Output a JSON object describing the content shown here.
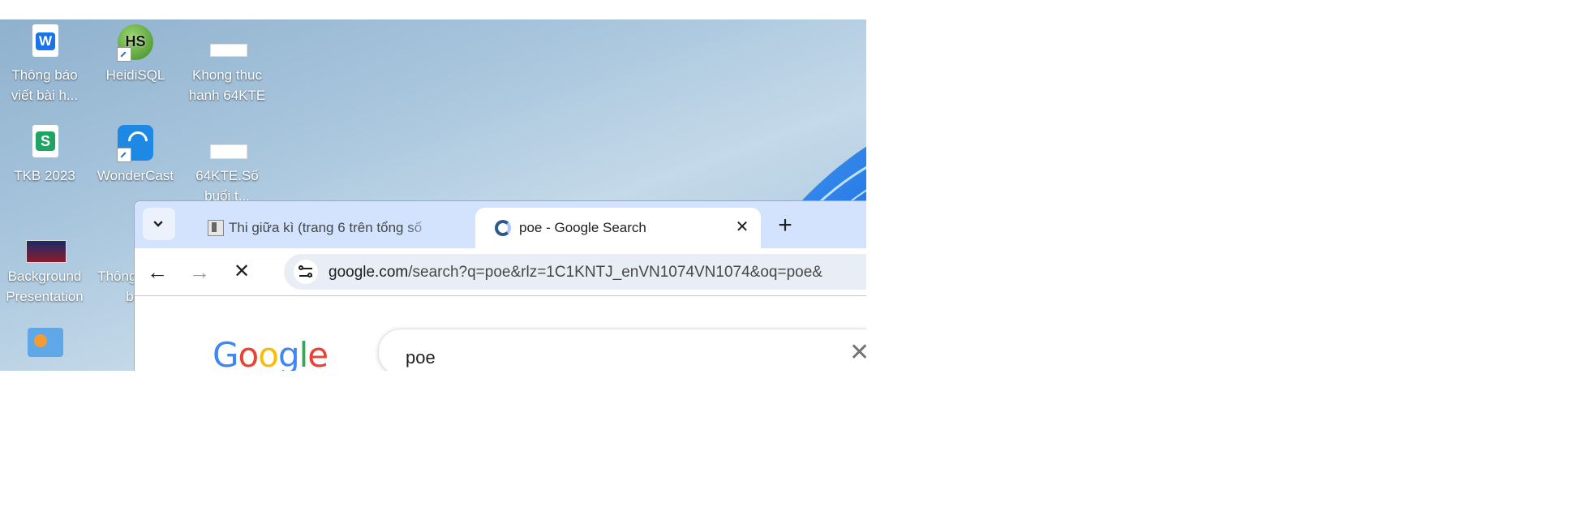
{
  "desktop": {
    "icons": [
      {
        "label": "Thông báo viết bài h...",
        "icon": "wps-writer-doc-icon",
        "color": "#1a73e8"
      },
      {
        "label": "HeidiSQL",
        "icon": "heidisql-icon",
        "color": "#5aa63a"
      },
      {
        "label": "Khong thuc hanh 64KTE",
        "icon": "document-thumbnail-icon"
      },
      {
        "label": "TKB 2023",
        "icon": "wps-spreadsheet-icon",
        "color": "#1fa463"
      },
      {
        "label": "WonderCast",
        "icon": "wondercast-icon",
        "color": "#1e88e5"
      },
      {
        "label": "64KTE.Số buổi t...",
        "icon": "document-thumbnail-icon"
      },
      {
        "label": "Background Presentation",
        "icon": "presentation-thumbnail-icon"
      },
      {
        "label": "Thông... viết b...",
        "icon": "wps-presentation-icon",
        "color": "#e5533d"
      },
      {
        "label": "",
        "icon": "dashboard-app-icon"
      },
      {
        "label": "",
        "icon": "zoom-icon"
      }
    ]
  },
  "browser": {
    "tabs": [
      {
        "title": "Thi giữa kì (trang 6 trên tổng số",
        "icon": "document-favicon-icon",
        "active": false
      },
      {
        "title": "poe - Google Search",
        "icon": "loading-favicon-icon",
        "active": true
      }
    ],
    "tab_search_icon": "chevron-down-icon",
    "new_tab_label": "+",
    "close_glyph": "✕",
    "nav": {
      "back": "←",
      "forward": "→",
      "stop": "✕"
    },
    "address_bar": {
      "host": "google.com",
      "path": "/search?q=poe&rlz=1C1KNTJ_enVN1074VN1074&oq=poe&"
    },
    "page": {
      "logo_letters": [
        "G",
        "o",
        "o",
        "g",
        "l",
        "e"
      ],
      "logo_colors": [
        "#4285f4",
        "#ea4335",
        "#fbbc05",
        "#4285f4",
        "#34a853",
        "#ea4335"
      ],
      "search_query": "poe",
      "clear_glyph": "✕"
    }
  }
}
